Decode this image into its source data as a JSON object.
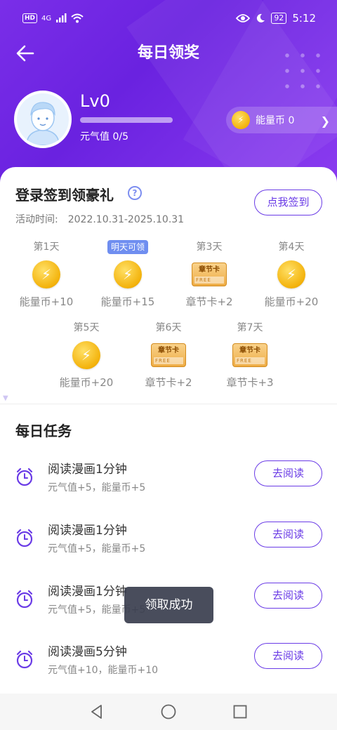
{
  "status_bar": {
    "hd": "HD",
    "signal": "4G",
    "battery": "92",
    "time": "5:12"
  },
  "header": {
    "title": "每日领奖",
    "level": "Lv0",
    "vitality": "元气值 0/5",
    "energy_label": "能量币 0",
    "vitality_progress": 0
  },
  "signin": {
    "title": "登录签到领豪礼",
    "activity_label": "活动时间:",
    "activity_range": "2022.10.31-2025.10.31",
    "button": "点我签到",
    "days": [
      {
        "label": "第1天",
        "reward": "能量币+10",
        "icon": "energy-coin-icon"
      },
      {
        "label": "明天可领",
        "reward": "能量币+15",
        "icon": "energy-coin-icon",
        "highlight": true
      },
      {
        "label": "第3天",
        "reward": "章节卡+2",
        "icon": "chapter-card-icon"
      },
      {
        "label": "第4天",
        "reward": "能量币+20",
        "icon": "energy-coin-icon"
      },
      {
        "label": "第5天",
        "reward": "能量币+20",
        "icon": "energy-coin-icon"
      },
      {
        "label": "第6天",
        "reward": "章节卡+2",
        "icon": "chapter-card-icon"
      },
      {
        "label": "第7天",
        "reward": "章节卡+3",
        "icon": "chapter-card-icon"
      }
    ],
    "card_text": "章节卡",
    "card_free": "FREE"
  },
  "tasks": {
    "title": "每日任务",
    "items": [
      {
        "title": "阅读漫画1分钟",
        "reward": "元气值+5，能量币+5",
        "button": "去阅读"
      },
      {
        "title": "阅读漫画1分钟",
        "reward": "元气值+5，能量币+5",
        "button": "去阅读"
      },
      {
        "title": "阅读漫画1分钟",
        "reward": "元气值+5，能量币+5",
        "button": "去阅读"
      },
      {
        "title": "阅读漫画5分钟",
        "reward": "元气值+10，能量币+10",
        "button": "去阅读"
      }
    ]
  },
  "toast": "领取成功",
  "colors": {
    "header": "#7a2ee8",
    "accent": "#6a3be6",
    "coin": "#f3b20b",
    "tag": "#6f8ef0"
  }
}
